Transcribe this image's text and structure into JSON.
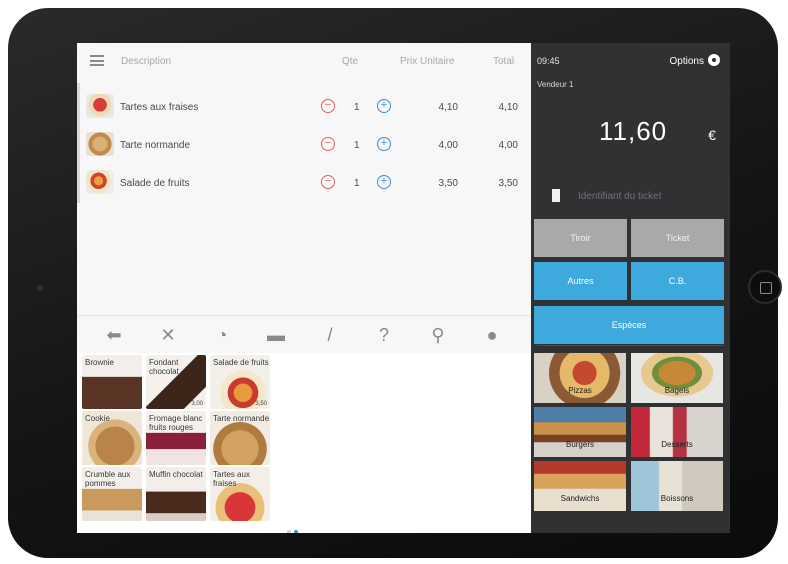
{
  "order": {
    "headers": {
      "description": "Description",
      "qty": "Qte",
      "unit_price": "Prix Unitaire",
      "total": "Total"
    },
    "items": [
      {
        "name": "Tartes aux fraises",
        "qty": "1",
        "unit": "4,10",
        "total": "4,10"
      },
      {
        "name": "Tarte normande",
        "qty": "1",
        "unit": "4,00",
        "total": "4,00"
      },
      {
        "name": "Salade de fruits",
        "qty": "1",
        "unit": "3,50",
        "total": "3,50"
      }
    ],
    "minus_symbol": "−",
    "plus_symbol": "+"
  },
  "toolbar": {
    "icons": [
      "back-arrow-icon",
      "close-icon",
      "timer-icon",
      "cash-register-icon",
      "pencil-icon",
      "help-icon",
      "search-icon",
      "user-icon"
    ],
    "glyphs": [
      "⬅",
      "✕",
      "◔",
      "▬",
      "/",
      "?",
      "⚲",
      "●"
    ]
  },
  "products": [
    {
      "label": "Brownie",
      "price": "3,00"
    },
    {
      "label": "Fondant chocolat",
      "price": "3,00"
    },
    {
      "label": "Salade de fruits",
      "price": "3,50"
    },
    {
      "label": "Cookie",
      "price": ""
    },
    {
      "label": "Fromage blanc fruits rouges",
      "price": ""
    },
    {
      "label": "Tarte normande",
      "price": ""
    },
    {
      "label": "Crumble aux pommes",
      "price": ""
    },
    {
      "label": "Muffin chocolat",
      "price": ""
    },
    {
      "label": "Tartes aux fraises",
      "price": ""
    }
  ],
  "pagination": {
    "pages": 2,
    "current": 2
  },
  "register": {
    "time": "09:45",
    "options_label": "Options",
    "seller": "Vendeur 1",
    "amount": "11,60",
    "currency": "€",
    "ticket_placeholder": "Identifiant du ticket",
    "buttons": {
      "drawer": "Tiroir",
      "ticket": "Ticket",
      "other": "Autres",
      "card": "C.B.",
      "cash": "Espèces"
    }
  },
  "categories": [
    {
      "label": "Pizzas"
    },
    {
      "label": "Bagels"
    },
    {
      "label": "Burgers"
    },
    {
      "label": "Desserts"
    },
    {
      "label": "Sandwichs"
    },
    {
      "label": "Boissons"
    }
  ],
  "colors": {
    "accent_blue": "#3da9dd",
    "minus_red": "#e2615f",
    "plus_blue": "#3d8fd6",
    "panel_dark": "#2f3133",
    "button_gray": "#a9a9a9"
  }
}
